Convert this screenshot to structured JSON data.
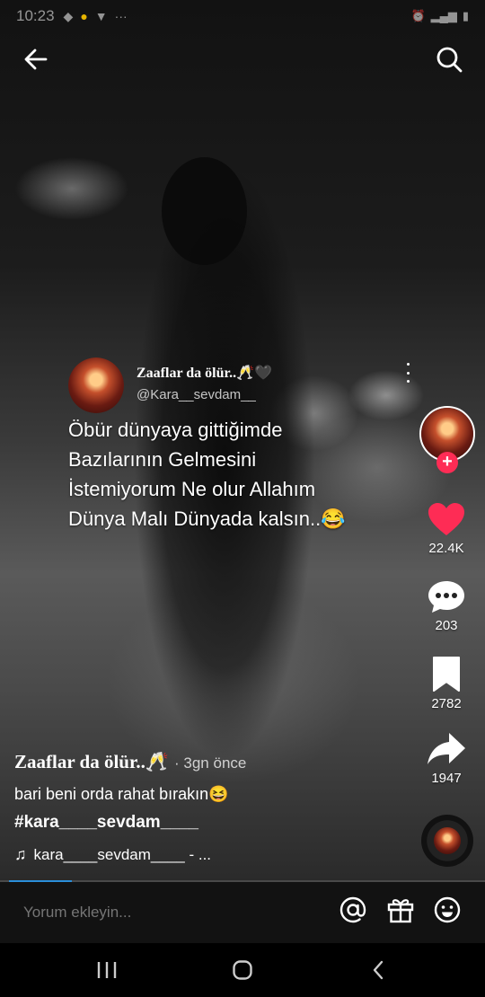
{
  "status_bar": {
    "time": "10:23"
  },
  "overlay": {
    "name": "Zaaflar da ölür..🥂🖤",
    "handle": "@Kara__sevdam__",
    "text_lines": [
      "Öbür dünyaya gittiğimde",
      "Bazılarının Gelmesini",
      "İstemiyorum Ne olur Allahım",
      "Dünya Malı Dünyada kalsın..😂"
    ]
  },
  "rail": {
    "follow_label": "+",
    "likes": "22.4K",
    "comments": "203",
    "bookmarks": "2782",
    "shares": "1947"
  },
  "caption": {
    "author": "Zaaflar da ölür..🥂",
    "time": "· 3gn önce",
    "text": "bari beni orda rahat bırakın😆",
    "hashtag": "#kara____sevdam____",
    "music": "kara____sevdam____ - ..."
  },
  "progress": {
    "fraction": 0.13
  },
  "comment_bar": {
    "placeholder": "Yorum ekleyin..."
  },
  "colors": {
    "like": "#fe2c55",
    "follow": "#fe2c55",
    "progress": "#2a8ed9"
  },
  "icons": [
    "back-arrow-icon",
    "search-icon",
    "heart-icon",
    "comment-icon",
    "bookmark-icon",
    "share-icon",
    "music-note-icon",
    "at-icon",
    "gift-icon",
    "emoji-icon",
    "recents-icon",
    "home-icon",
    "nav-back-icon"
  ]
}
